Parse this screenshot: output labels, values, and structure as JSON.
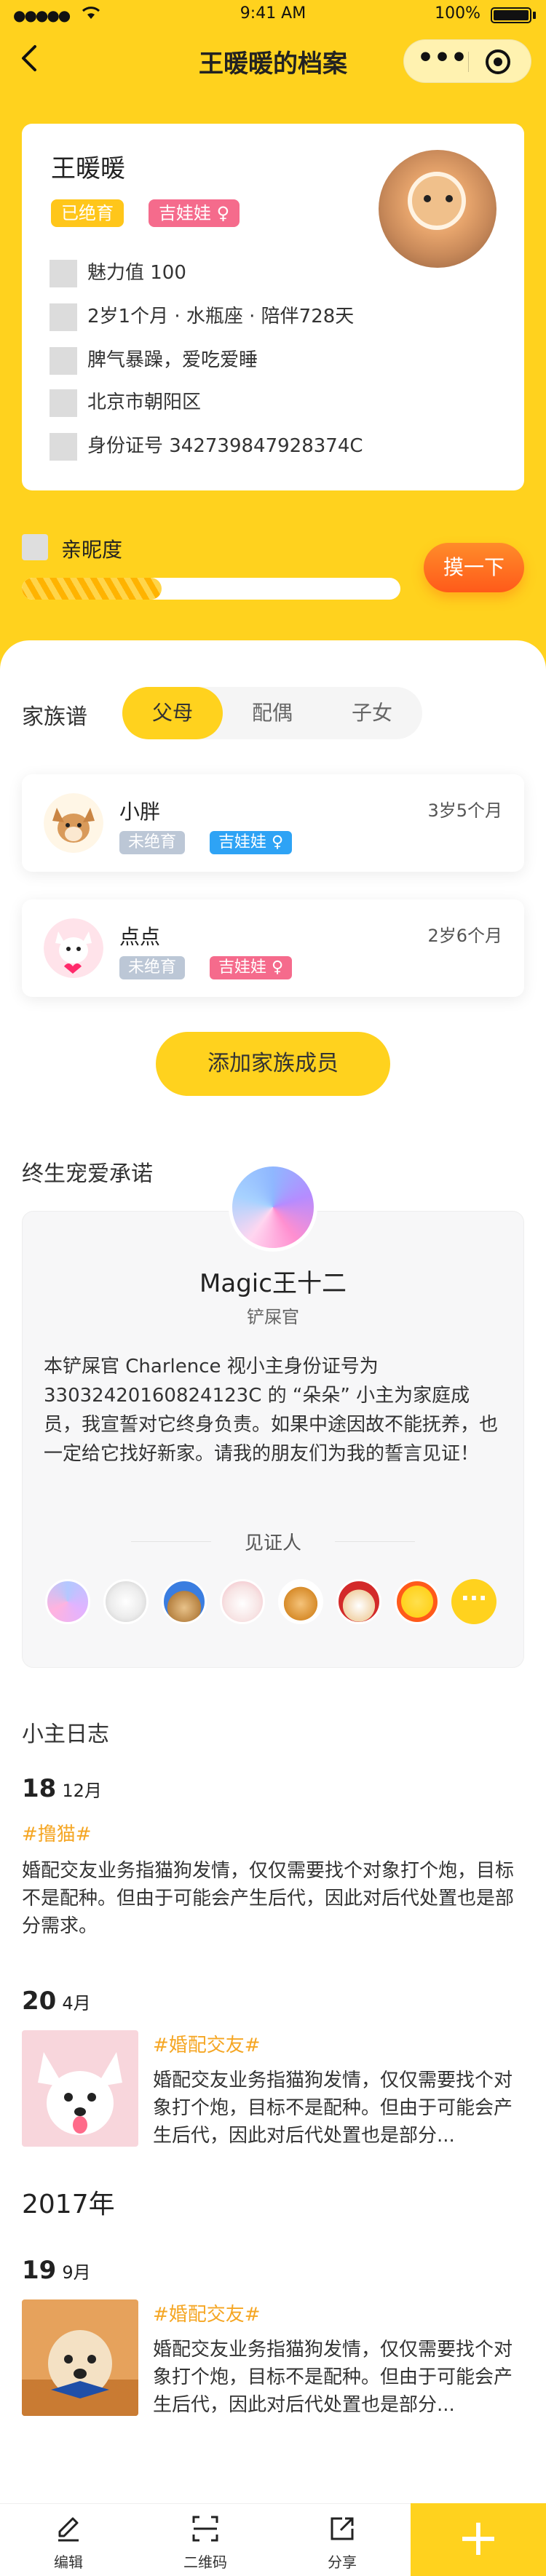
{
  "status_bar": {
    "signal": "●●●●●",
    "time": "9:41 AM",
    "battery": "100%"
  },
  "nav": {
    "title": "王暖暖的档案"
  },
  "profile": {
    "name": "王暖暖",
    "tags": [
      "已绝育",
      "吉娃娃 ♀"
    ],
    "info": [
      "魅力值 100",
      "2岁1个月 · 水瓶座 · 陪伴728天",
      "脾气暴躁，爱吃爱睡",
      "北京市朝阳区",
      "身份证号 342739847928374C"
    ],
    "accent_color": "#ffd21e"
  },
  "intimacy": {
    "label": "亲昵度",
    "level": 0.37,
    "button": "摸一下"
  },
  "family": {
    "label": "家族谱",
    "tabs": [
      "父母",
      "配偶",
      "子女"
    ],
    "active_tab": "父母",
    "members": [
      {
        "name": "小胖",
        "age": "3岁5个月",
        "tags": [
          "未绝育",
          "吉娃娃 ♀"
        ]
      },
      {
        "name": "点点",
        "age": "2岁6个月",
        "tags": [
          "未绝育",
          "吉娃娃 ♀"
        ]
      }
    ],
    "add_button": "添加家族成员"
  },
  "pledge": {
    "title": "终生宠爱承诺",
    "name": "Magic王十二",
    "role": "铲屎官",
    "text": "本铲屎官 Charlence 视小主身份证号为 33032420160824123C 的 “朵朵” 小主为家庭成员，我宣誓对它终身负责。如果中途因故不能抚养，也一定给它找好新家。请我的朋友们为我的誓言见证！",
    "witness_label": "见证人",
    "more": "···"
  },
  "diary": {
    "title": "小主日志",
    "year": "2017年",
    "entries": [
      {
        "day": "18",
        "month": "12月",
        "tag": "#撸猫#",
        "text": "婚配交友业务指猫狗发情，仅仅需要找个对象打个炮，目标不是配种。但由于可能会产生后代，因此对后代处置也是部分需求。"
      },
      {
        "day": "20",
        "month": "4月",
        "tag": "#婚配交友#",
        "text": "婚配交友业务指猫狗发情，仅仅需要找个对象打个炮，目标不是配种。但由于可能会产生后代，因此对后代处置也是部分..."
      },
      {
        "day": "19",
        "month": "9月",
        "tag": "#婚配交友#",
        "text": "婚配交友业务指猫狗发情，仅仅需要找个对象打个炮，目标不是配种。但由于可能会产生后代，因此对后代处置也是部分..."
      }
    ]
  },
  "tabbar": {
    "items": [
      "编辑",
      "二维码",
      "分享"
    ],
    "add": "+"
  }
}
